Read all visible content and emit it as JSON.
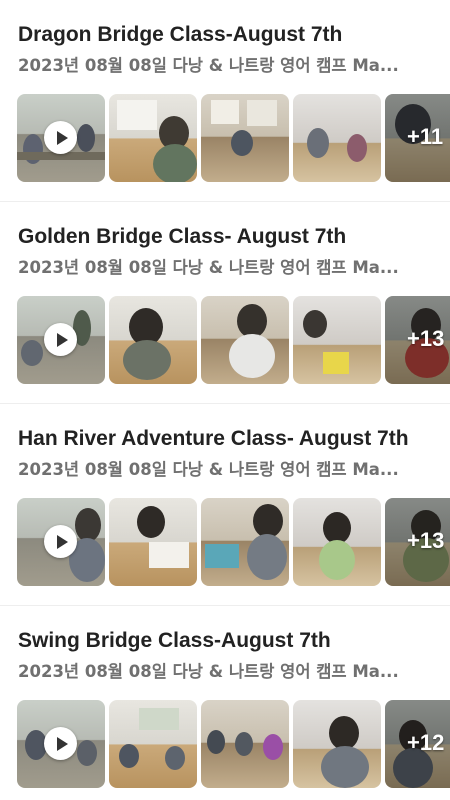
{
  "posts": [
    {
      "title": "Dragon Bridge Class-August 7th",
      "subtitle": "2023년 08월 08일 다낭 & 나트랑 영어 캠프 Ma...",
      "more_count": "+11"
    },
    {
      "title": "Golden Bridge Class- August 7th",
      "subtitle": "2023년 08월 08일 다낭 & 나트랑 영어 캠프 Ma...",
      "more_count": "+13"
    },
    {
      "title": "Han River Adventure Class- August 7th",
      "subtitle": "2023년 08월 08일 다낭 & 나트랑 영어 캠프 Ma...",
      "more_count": "+13"
    },
    {
      "title": "Swing Bridge Class-August 7th",
      "subtitle": "2023년 08월 08일 다낭 & 나트랑 영어 캠프 Ma...",
      "more_count": "+12"
    }
  ],
  "icons": {
    "play": "play-icon"
  }
}
